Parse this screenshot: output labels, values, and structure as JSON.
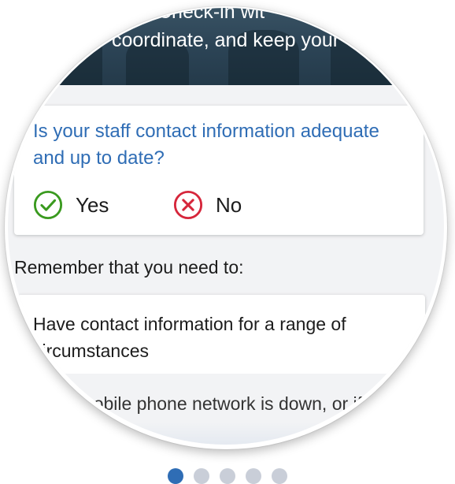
{
  "hero": {
    "line1": "Check-in wit",
    "line2": "coordinate, and keep your"
  },
  "question": {
    "text": "Is your staff contact information adequate and up to date?",
    "yes_label": "Yes",
    "no_label": "No",
    "yes_icon": "check-circle-icon",
    "no_icon": "x-circle-icon"
  },
  "reminder": {
    "heading": "Remember that you need to:",
    "card_title": "Have contact information for a range of circumstances",
    "card_body": "If the mobile phone network is down, or if staff are available"
  },
  "pager": {
    "count": 5,
    "active_index": 0
  },
  "colors": {
    "accent": "#2f6db5",
    "yes": "#3a9a1f",
    "no": "#d6263b",
    "dot_inactive": "#c9ced8"
  }
}
